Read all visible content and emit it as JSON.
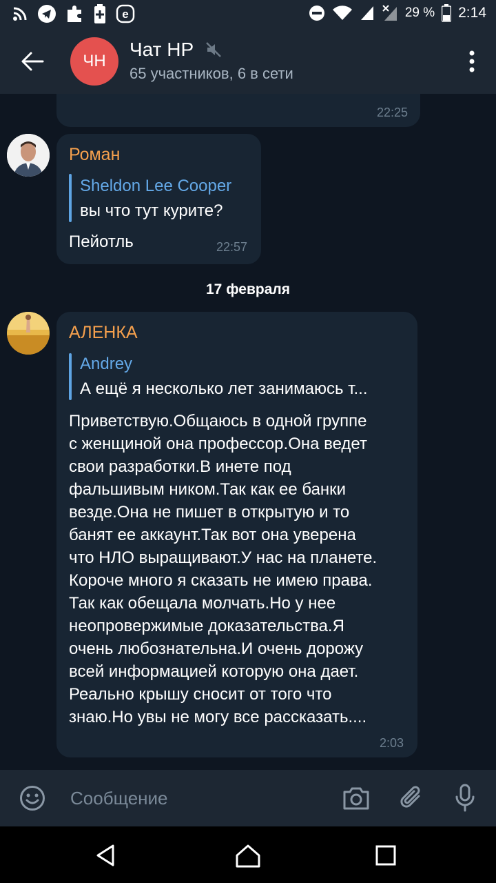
{
  "status_bar": {
    "battery": "29 %",
    "time": "2:14",
    "left_icons": [
      "rss-icon",
      "telegram-icon",
      "puzzle-icon",
      "battery-plus-icon",
      "e-icon"
    ],
    "right_icons": [
      "dnd-icon",
      "wifi-icon",
      "signal-icon",
      "signal-x-icon",
      "battery-icon"
    ]
  },
  "header": {
    "avatar_initials": "ЧН",
    "title": "Чат НР",
    "subtitle": "65 участников, 6 в сети",
    "avatar_color": "#e4514f"
  },
  "messages": {
    "m0": {
      "time": "22:25"
    },
    "m1": {
      "sender": "Роман",
      "reply_name": "Sheldon Lee Cooper",
      "reply_text": "вы что тут курите?",
      "text": "Пейотль",
      "time": "22:57"
    },
    "date_separator": "17 февраля",
    "m2": {
      "sender": "АЛЕНКА",
      "reply_name": "Andrey",
      "reply_text": "А ещё я несколько лет занимаюсь т...",
      "lines": [
        "Приветствую.Общаюсь в одной группе",
        "с женщиной она профессор.Она ведет",
        "свои разработки.В инете под",
        "фальшивым ником.Так как ее банки",
        "везде.Она не пишет в открытую и то",
        "банят ее аккаунт.Так вот она уверена",
        "что НЛО выращивают.У нас на планете.",
        "Короче много я сказать не имею права.",
        "Так как обещала молчать.Но у нее",
        "неопровержимые доказательства.Я",
        "очень любознательна.И очень дорожу",
        "всей информацией которую она дает.",
        "Реально крышу сносит от того что",
        "знаю.Но увы не могу все рассказать...."
      ],
      "time": "2:03"
    }
  },
  "composer": {
    "placeholder": "Сообщение"
  },
  "colors": {
    "background": "#0e1621",
    "bar": "#1d2733",
    "bubble": "#182533",
    "sender": "#f5a04d",
    "reply_accent": "#64a9e8"
  }
}
